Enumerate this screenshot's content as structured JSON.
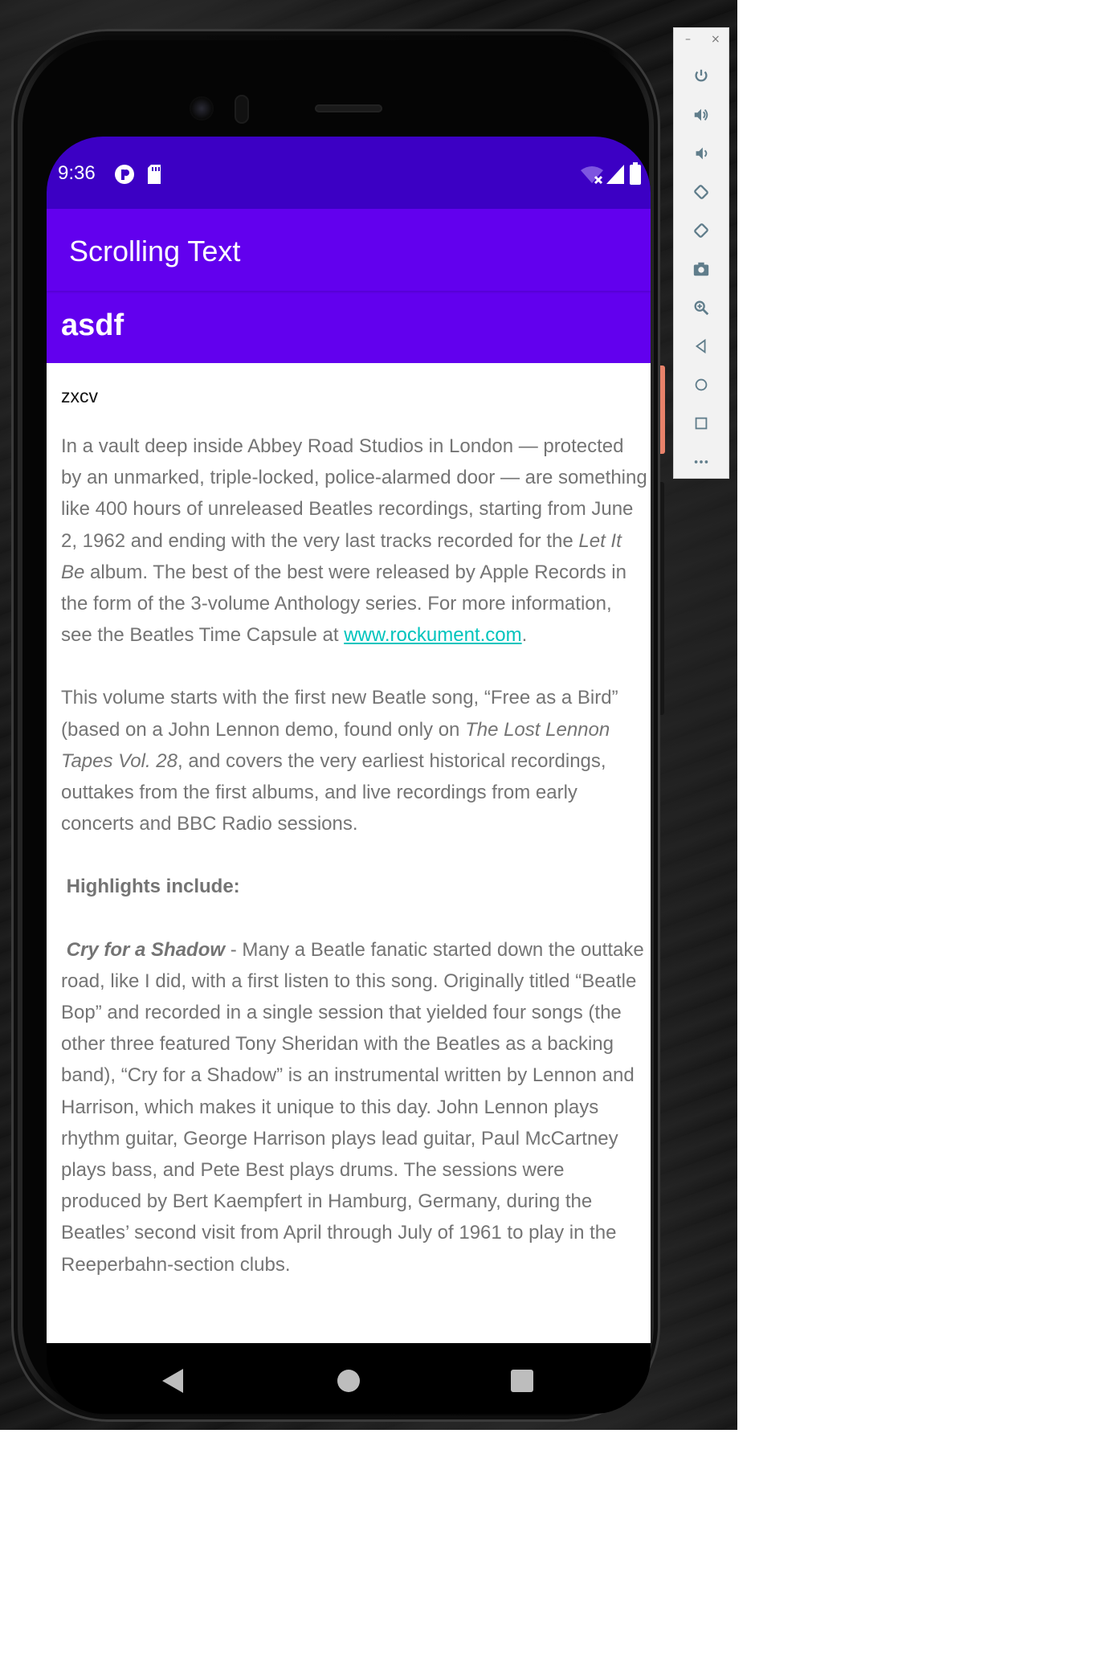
{
  "status_bar": {
    "time": "9:36"
  },
  "app_bar": {
    "title": "Scrolling Text"
  },
  "header": {
    "title": "asdf",
    "subtitle": "zxcv"
  },
  "article": {
    "p1_text": "In a vault deep inside Abbey Road Studios in London — protected by an unmarked, triple-locked, police-alarmed door — are something like 400 hours of unreleased Beatles recordings, starting from June 2, 1962 and ending with the very last tracks recorded for the ",
    "p1_italic": "Let It Be",
    "p1_text2": " album. The best of the best were released by Apple Records in the form of the 3-volume Anthology series. For more information, see the Beatles Time Capsule at ",
    "p1_link": "www.rockument.com",
    "p1_end": ".",
    "p2_text": " This volume starts with the first new Beatle song, “Free as a Bird” (based on a John Lennon demo, found only on ",
    "p2_italic": "The Lost Lennon Tapes Vol. 28",
    "p2_text2": ", and covers the very earliest historical recordings, outtakes from the first albums, and live recordings from early concerts and BBC Radio sessions.",
    "highlights_heading": "Highlights include:",
    "p3_bold_italic": "Cry for a Shadow",
    "p3_text": " - Many a Beatle fanatic started down the outtake road, like I did, with a first listen to this song. Originally titled “Beatle Bop” and recorded in a single session that yielded four songs (the other three featured Tony Sheridan with the Beatles as a backing band), “Cry for a Shadow” is an instrumental written by Lennon and Harrison, which makes it unique to this day. John Lennon plays rhythm guitar, George Harrison plays lead guitar, Paul McCartney plays bass, and Pete Best plays drums. The sessions were produced by Bert Kaempfert in Hamburg, Germany, during the Beatles’ second visit from April through July of 1961 to play in the Reeperbahn-section clubs.",
    "link_color": "#00c4bd"
  },
  "emulator_toolbar": {
    "minimize": "–",
    "close": "×",
    "buttons": [
      "power-icon",
      "volume-up-icon",
      "volume-down-icon",
      "rotate-left-icon",
      "rotate-right-icon",
      "camera-icon",
      "zoom-icon",
      "back-icon",
      "home-icon",
      "overview-icon",
      "more-icon"
    ]
  },
  "colors": {
    "status_bar": "#3c00c4",
    "app_bar": "#6200ee",
    "body_text": "#747474"
  }
}
